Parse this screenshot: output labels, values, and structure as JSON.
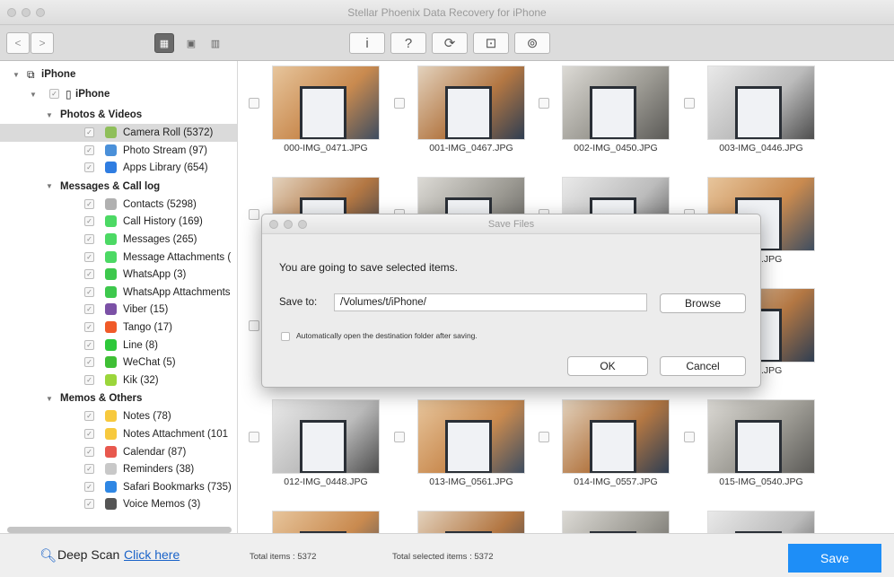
{
  "window": {
    "title": "Stellar Phoenix Data Recovery for iPhone"
  },
  "toolbar": {
    "nav_back_icon": "chevron-left-icon",
    "nav_forward_icon": "chevron-right-icon",
    "view_buttons": [
      "grid-view-icon",
      "preview-view-icon",
      "list-view-icon"
    ],
    "action_buttons": [
      {
        "name": "info-icon",
        "glyph": "i"
      },
      {
        "name": "help-icon",
        "glyph": "?"
      },
      {
        "name": "refresh-icon",
        "glyph": "⟳"
      },
      {
        "name": "cart-icon",
        "glyph": "⊡"
      },
      {
        "name": "user-icon",
        "glyph": "⊚"
      }
    ]
  },
  "sidebar": {
    "root": "iPhone",
    "device": "iPhone",
    "groups": [
      {
        "label": "Photos & Videos",
        "items": [
          {
            "label": "Camera Roll (5372)",
            "icon": "flower-icon",
            "color": "#8fbf5a",
            "selected": true
          },
          {
            "label": "Photo Stream (97)",
            "icon": "cloud-icon",
            "color": "#4a90d9"
          },
          {
            "label": "Apps Library (654)",
            "icon": "appstore-icon",
            "color": "#2f7de1"
          }
        ]
      },
      {
        "label": "Messages & Call log",
        "items": [
          {
            "label": "Contacts (5298)",
            "icon": "contacts-icon",
            "color": "#b0b0b0"
          },
          {
            "label": "Call History (169)",
            "icon": "phone-icon",
            "color": "#4cd964"
          },
          {
            "label": "Messages (265)",
            "icon": "messages-icon",
            "color": "#4cd964"
          },
          {
            "label": "Message Attachments (",
            "icon": "attachment-icon",
            "color": "#4cd964"
          },
          {
            "label": "WhatsApp (3)",
            "icon": "whatsapp-icon",
            "color": "#3ec84d"
          },
          {
            "label": "WhatsApp Attachments",
            "icon": "whatsapp-attachment-icon",
            "color": "#3ec84d"
          },
          {
            "label": "Viber (15)",
            "icon": "viber-icon",
            "color": "#7b51a6"
          },
          {
            "label": "Tango (17)",
            "icon": "tango-icon",
            "color": "#f05a28"
          },
          {
            "label": "Line (8)",
            "icon": "line-icon",
            "color": "#2ec83a"
          },
          {
            "label": "WeChat (5)",
            "icon": "wechat-icon",
            "color": "#3fbf35"
          },
          {
            "label": "Kik (32)",
            "icon": "kik-icon",
            "color": "#9bd63b"
          }
        ]
      },
      {
        "label": "Memos & Others",
        "items": [
          {
            "label": "Notes (78)",
            "icon": "notes-icon",
            "color": "#f7c93e"
          },
          {
            "label": "Notes Attachment (101",
            "icon": "notes-attachment-icon",
            "color": "#f7c93e"
          },
          {
            "label": "Calendar (87)",
            "icon": "calendar-icon",
            "color": "#e8584e"
          },
          {
            "label": "Reminders (38)",
            "icon": "reminders-icon",
            "color": "#c8c8c8"
          },
          {
            "label": "Safari Bookmarks (735)",
            "icon": "safari-icon",
            "color": "#2f87e4"
          },
          {
            "label": "Voice Memos (3)",
            "icon": "voice-memo-icon",
            "color": "#555555"
          }
        ]
      }
    ]
  },
  "grid": {
    "files": [
      "000-IMG_0471.JPG",
      "001-IMG_0467.JPG",
      "002-IMG_0450.JPG",
      "003-IMG_0446.JPG",
      "",
      "",
      "",
      "0513.JPG",
      "",
      "",
      "",
      "0452.JPG",
      "012-IMG_0448.JPG",
      "013-IMG_0561.JPG",
      "014-IMG_0557.JPG",
      "015-IMG_0540.JPG"
    ]
  },
  "dialog": {
    "title": "Save Files",
    "message": "You are going to save selected items.",
    "save_to_label": "Save to:",
    "path_value": "/Volumes/t/iPhone/",
    "browse_label": "Browse",
    "auto_open_label": "Automatically open the destination folder after saving.",
    "ok_label": "OK",
    "cancel_label": "Cancel"
  },
  "footer": {
    "deep_scan_label": "Deep Scan",
    "click_here_label": "Click here",
    "total_items": "Total items : 5372",
    "total_selected": "Total selected items : 5372",
    "save_label": "Save"
  },
  "colors": {
    "accent": "#1e8ef7",
    "link": "#1a63c8"
  }
}
